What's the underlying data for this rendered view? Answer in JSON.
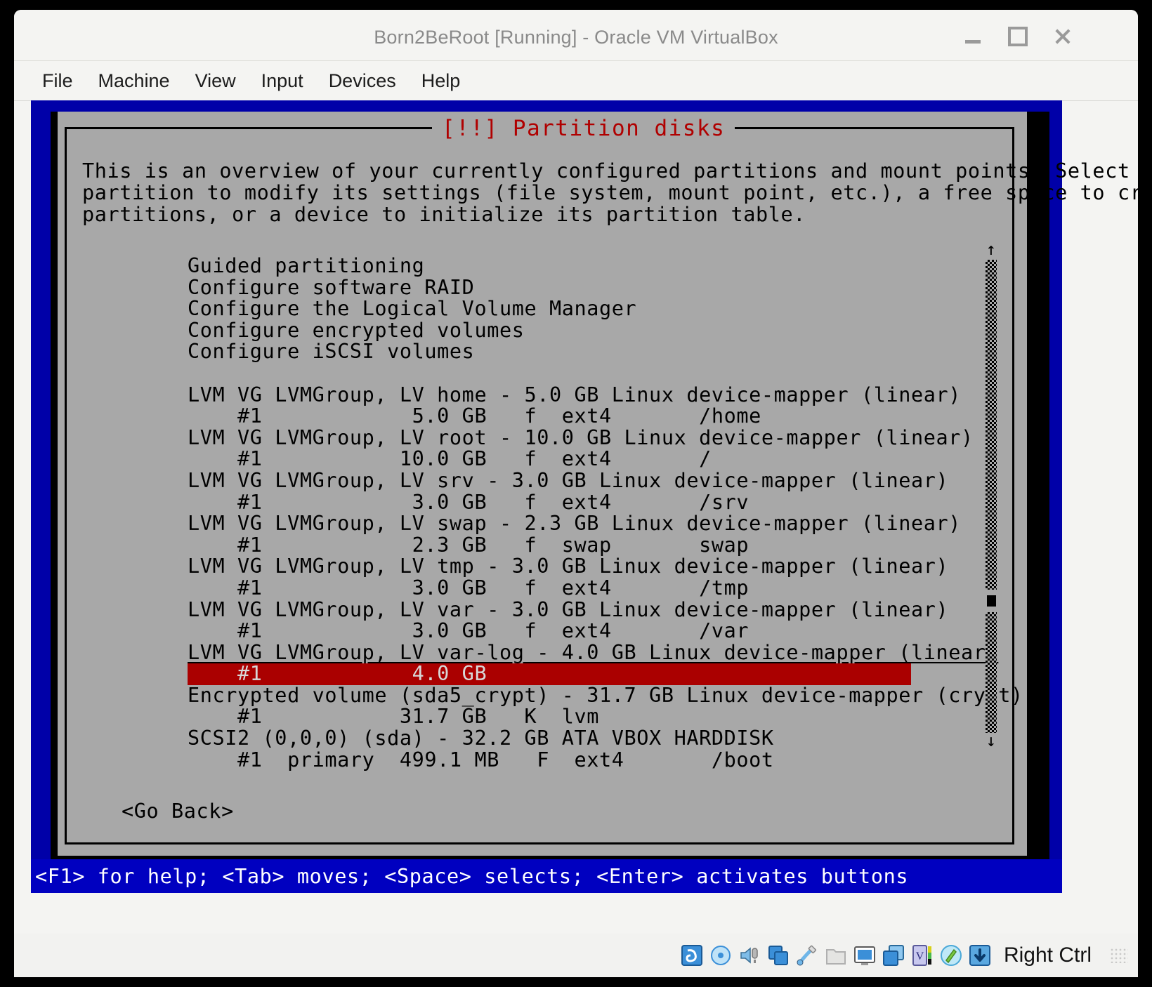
{
  "window": {
    "title": "Born2BeRoot [Running] - Oracle VM VirtualBox",
    "controls": {
      "minimize": "—",
      "maximize": "▫",
      "close": "✕"
    }
  },
  "menubar": {
    "items": [
      {
        "label": "File"
      },
      {
        "label": "Machine"
      },
      {
        "label": "View"
      },
      {
        "label": "Input"
      },
      {
        "label": "Devices"
      },
      {
        "label": "Help"
      }
    ]
  },
  "installer": {
    "dialog_title": "[!!] Partition disks",
    "body_line1": "This is an overview of your currently configured partitions and mount points. Select a",
    "body_line2": "partition to modify its settings (file system, mount point, etc.), a free space to create",
    "body_line3": "partitions, or a device to initialize its partition table.",
    "menu_options": [
      "Guided partitioning",
      "Configure software RAID",
      "Configure the Logical Volume Manager",
      "Configure encrypted volumes",
      "Configure iSCSI volumes"
    ],
    "partitions": [
      "LVM VG LVMGroup, LV home - 5.0 GB Linux device-mapper (linear)",
      "    #1            5.0 GB   f  ext4       /home",
      "LVM VG LVMGroup, LV root - 10.0 GB Linux device-mapper (linear)",
      "    #1           10.0 GB   f  ext4       /",
      "LVM VG LVMGroup, LV srv - 3.0 GB Linux device-mapper (linear)",
      "    #1            3.0 GB   f  ext4       /srv",
      "LVM VG LVMGroup, LV swap - 2.3 GB Linux device-mapper (linear)",
      "    #1            2.3 GB   f  swap       swap",
      "LVM VG LVMGroup, LV tmp - 3.0 GB Linux device-mapper (linear)",
      "    #1            3.0 GB   f  ext4       /tmp",
      "LVM VG LVMGroup, LV var - 3.0 GB Linux device-mapper (linear)",
      "    #1            3.0 GB   f  ext4       /var",
      "LVM VG LVMGroup, LV var-log - 4.0 GB Linux device-mapper (linear)",
      "    #1            4.0 GB",
      "Encrypted volume (sda5_crypt) - 31.7 GB Linux device-mapper (crypt)",
      "    #1           31.7 GB   K  lvm",
      "SCSI2 (0,0,0) (sda) - 32.2 GB ATA VBOX HARDDISK",
      "    #1  primary  499.1 MB   F  ext4       /boot"
    ],
    "selected_row_index": 13,
    "underlined_row_index": 12,
    "go_back": "<Go Back>",
    "hint": "<F1> for help; <Tab> moves; <Space> selects; <Enter> activates buttons",
    "scrollbar": {
      "up_arrow": "↑",
      "down_arrow": "↓"
    },
    "colors": {
      "dialog_bg": "#a8a8a8",
      "title_red": "#b00000",
      "selection_red": "#aa0000",
      "frame_blue": "#0000a8",
      "hint_blue": "#0000c0"
    }
  },
  "statusbar": {
    "icons": [
      "hard-disk-icon",
      "optical-disk-icon",
      "audio-icon",
      "network-icon",
      "usb-icon",
      "shared-folders-icon",
      "display-icon",
      "recording-icon",
      "virtualization-icon",
      "mouse-integration-icon",
      "keyboard-capture-icon"
    ],
    "host_key": "Right Ctrl"
  }
}
